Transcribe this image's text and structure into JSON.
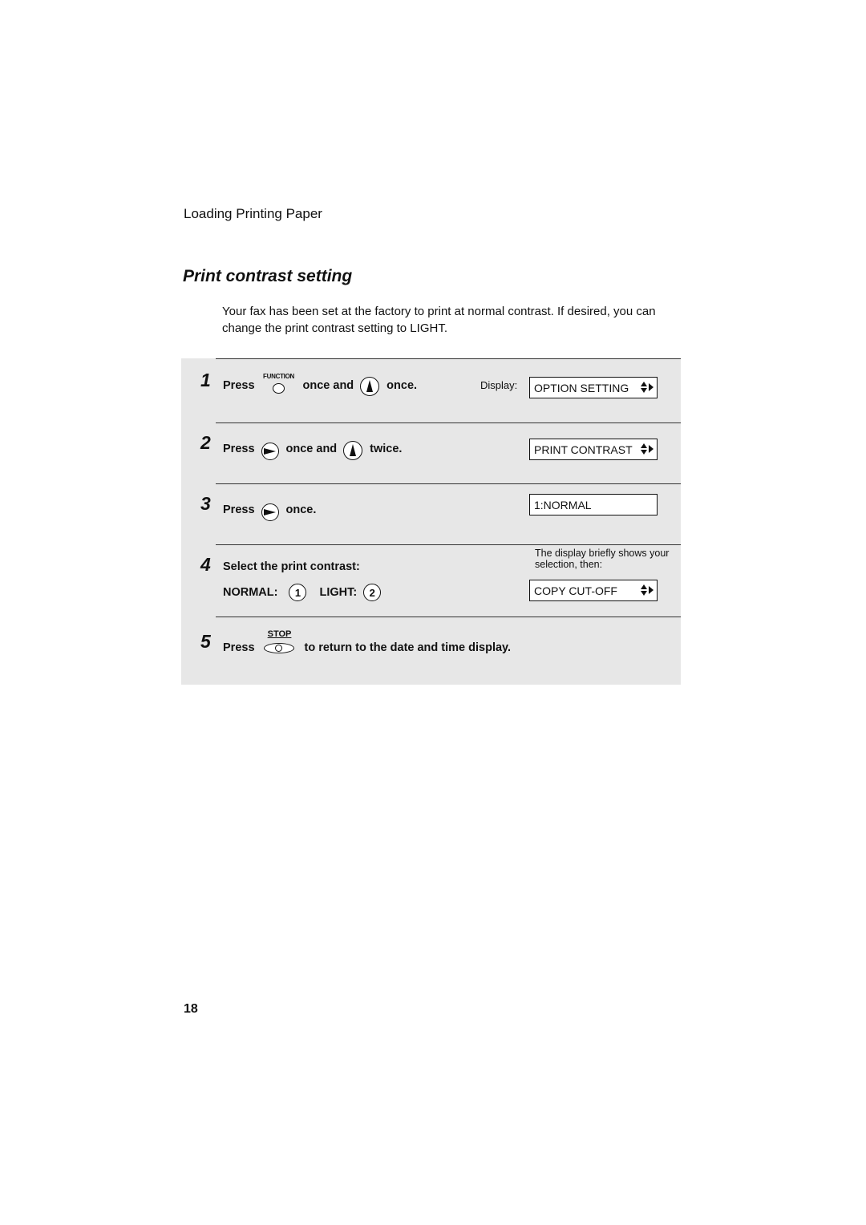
{
  "page": {
    "section_header": "Loading Printing Paper",
    "title": "Print contrast setting",
    "intro": "Your fax has been set at the factory to print at normal contrast. If desired, you can change the print contrast setting to LIGHT.",
    "page_number": "18"
  },
  "steps": [
    {
      "number": "1",
      "press": "Press",
      "button1_label": "FUNCTION",
      "button1_icon": "function-key-icon",
      "mid": "once and",
      "button2_icon": "up-arrow-key-icon",
      "end": "once."
    },
    {
      "number": "2",
      "press": "Press",
      "button1_icon": "right-arrow-key-icon",
      "mid": "once and",
      "button2_icon": "up-arrow-key-icon",
      "end": "twice."
    },
    {
      "number": "3",
      "press": "Press",
      "button1_icon": "right-arrow-key-icon",
      "end": "once."
    },
    {
      "number": "4",
      "text": "Select the print contrast:",
      "option1_label": "NORMAL:",
      "option1_key": "1",
      "option2_label": "LIGHT:",
      "option2_key": "2"
    },
    {
      "number": "5",
      "press": "Press",
      "button_label": "STOP",
      "button_icon": "stop-key-icon",
      "end": "to return to the date and time display."
    }
  ],
  "displays": {
    "label": "Display:",
    "screen1": "OPTION SETTING",
    "screen2": "PRINT CONTRAST",
    "screen3": "1:NORMAL",
    "note": "The display briefly shows your selection, then:",
    "screen4": "COPY CUT-OFF"
  }
}
